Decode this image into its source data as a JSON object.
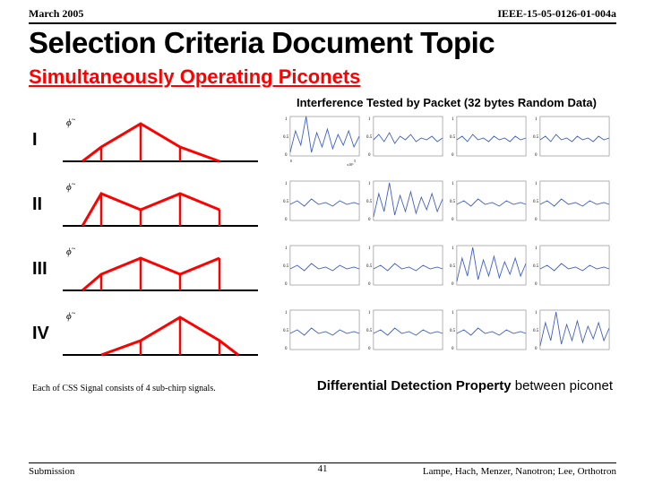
{
  "header": {
    "date": "March 2005",
    "doc_id": "IEEE-15-05-0126-01-004a"
  },
  "title": "Selection Criteria Document Topic",
  "subtitle": "Simultaneously Operating Piconets",
  "test_label": "Interference Tested by Packet (32 bytes Random Data)",
  "rows": [
    {
      "label": "I"
    },
    {
      "label": "II"
    },
    {
      "label": "III"
    },
    {
      "label": "IV"
    }
  ],
  "css_signals": {
    "I": {
      "peaks": [
        0.2,
        0.4,
        0.6,
        0.8
      ],
      "heights": [
        0.5,
        1.0,
        0.5,
        0.0
      ],
      "kind": "triangle"
    },
    "II": {
      "peaks": [
        0.2,
        0.4,
        0.6,
        0.8
      ],
      "heights": [
        0.7,
        0.4,
        0.7,
        0.4
      ],
      "kind": "m"
    },
    "III": {
      "peaks": [
        0.2,
        0.4,
        0.6,
        0.8
      ],
      "heights": [
        0.4,
        0.7,
        0.4,
        0.7
      ],
      "kind": "w"
    },
    "IV": {
      "peaks": [
        0.2,
        0.4,
        0.6,
        0.8
      ],
      "heights": [
        0.0,
        0.5,
        1.0,
        0.5
      ],
      "kind": "triangle-rev"
    }
  },
  "spectrum": {
    "cols": 4,
    "xticks": [
      "0",
      "1",
      "2",
      "3",
      "4",
      "5"
    ],
    "xscale": "x 10^6",
    "ylim": [
      0,
      1
    ],
    "yticks": [
      "0",
      "0.5",
      "1"
    ]
  },
  "captions": {
    "left": "Each of CSS Signal consists of 4 sub-chirp signals.",
    "right_bold": "Differential Detection Property",
    "right_rest": " between piconet"
  },
  "footer": {
    "submission": "Submission",
    "page": "41",
    "authors": "Lampe, Hach, Menzer, Nanotron; Lee, Orthotron"
  }
}
